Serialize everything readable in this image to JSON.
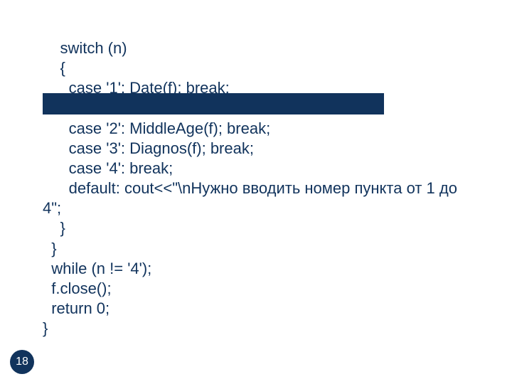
{
  "code": {
    "l1": "    switch (n)",
    "l2": "    {",
    "l3": "      case '1': Date(f); break;",
    "l4": " ",
    "l5": "      case '2': MiddleAge(f); break;",
    "l6": "      case '3': Diagnos(f); break;",
    "l7": "      case '4': break;",
    "l8": "      default: cout<<\"\\nНужно вводить номер пункта от 1 до",
    "l9": "4\";",
    "l10": "    }",
    "l11": "  }",
    "l12": "  while (n != '4');",
    "l13": "  f.close();",
    "l14": "  return 0;",
    "l15": "}"
  },
  "page_number": "18"
}
